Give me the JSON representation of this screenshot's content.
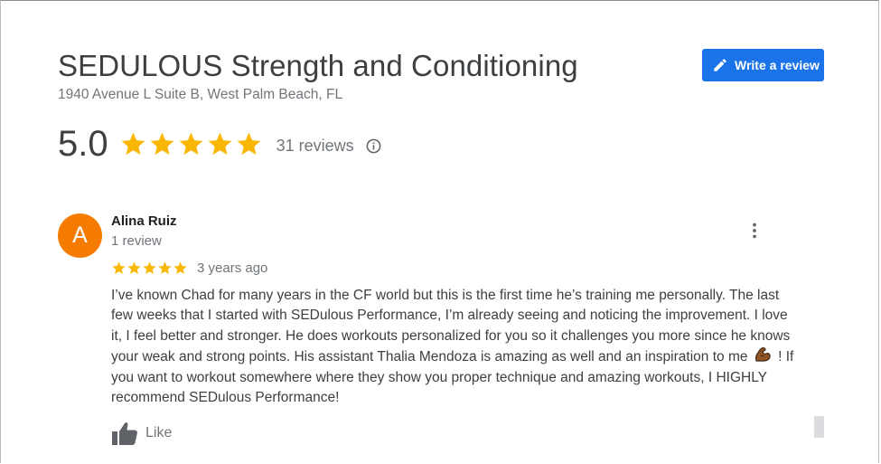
{
  "business": {
    "name": "SEDULOUS Strength and Conditioning",
    "address": "1940 Avenue L Suite B, West Palm Beach, FL"
  },
  "actions": {
    "write_review_label": "Write a review",
    "write_review_icon": "pencil-icon"
  },
  "summary": {
    "rating": "5.0",
    "stars": 5,
    "star_color": "#f9b603",
    "review_count": "31 reviews",
    "info_icon": "info-icon"
  },
  "review": {
    "avatar_letter": "A",
    "avatar_color": "#f57c00",
    "author": "Alina Ruiz",
    "author_meta": "1 review",
    "stars": 5,
    "date": "3 years ago",
    "text_part1": "I’ve known Chad for many years in the CF world but this is the first time he’s training me personally. The last few weeks that I started with SEDulous Performance, I’m already seeing and noticing the improvement. I love it, I feel better and stronger. He does workouts personalized for you so it challenges you more since he knows your weak and strong points. His assistant Thalia Mendoza is amazing as well and an inspiration to me",
    "emoji": "flexed-biceps-emoji",
    "text_part2": "! If you want to workout somewhere where they show you proper technique and amazing workouts, I HIGHLY recommend SEDulous Performance!",
    "like_label": "Like",
    "like_icon": "thumbs-up-icon",
    "more_icon": "more-vert-icon"
  },
  "colors": {
    "accent": "#1a73e8",
    "text_primary": "#3c4043",
    "text_secondary": "#70757a"
  }
}
